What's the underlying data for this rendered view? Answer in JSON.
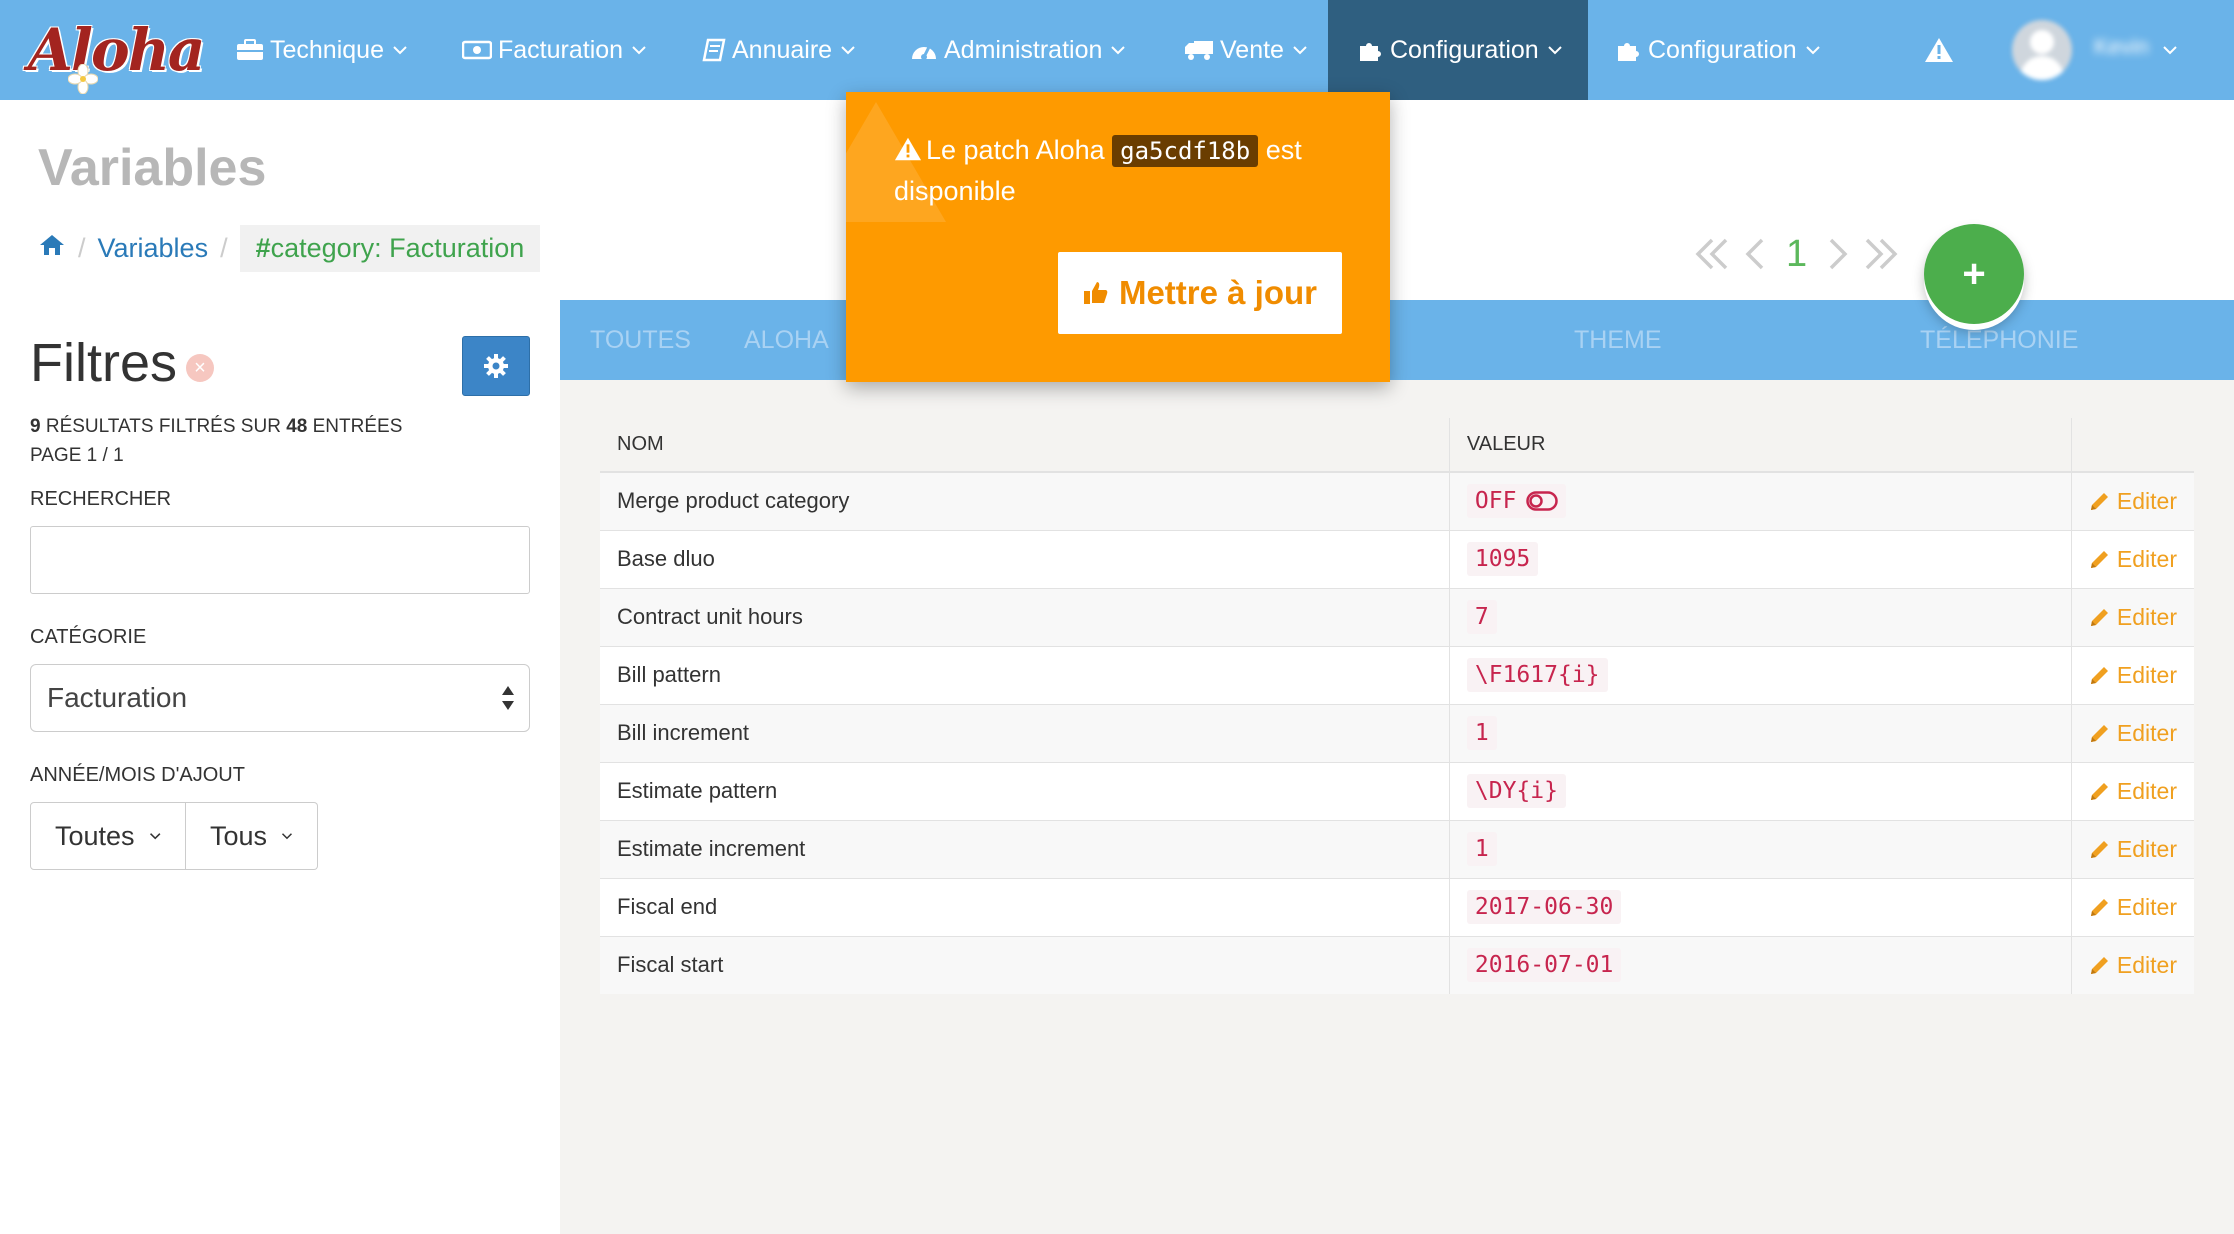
{
  "navbar": {
    "logo_text": "Aloha",
    "items": [
      {
        "label": "Technique",
        "icon": "briefcase-icon"
      },
      {
        "label": "Facturation",
        "icon": "money-icon"
      },
      {
        "label": "Annuaire",
        "icon": "book-icon"
      },
      {
        "label": "Administration",
        "icon": "dashboard-icon"
      },
      {
        "label": "Vente",
        "icon": "truck-icon"
      },
      {
        "label": "Configuration",
        "icon": "puzzle-icon",
        "active": true
      },
      {
        "label": "Configuration",
        "icon": "puzzle-icon"
      }
    ],
    "alert_icon": "warning-icon",
    "user_name": "Kevin"
  },
  "header": {
    "title": "Variables",
    "breadcrumb": {
      "home_icon": "home-icon",
      "variables": "Variables",
      "tag_hash": "#",
      "tag_label": "category: Facturation"
    },
    "pager": {
      "current_page": "1"
    },
    "add_button": "+"
  },
  "sidebar": {
    "title": "Filtres",
    "clear_icon": "×",
    "results_count": "9",
    "results_middle": " RÉSULTATS FILTRÉS SUR ",
    "results_total": "48",
    "results_end": " ENTRÉES",
    "page_info": "PAGE 1 / 1",
    "search_label": "RECHERCHER",
    "search_value": "",
    "category_label": "CATÉGORIE",
    "category_value": "Facturation",
    "date_label": "ANNÉE/MOIS D'AJOUT",
    "year_value": "Toutes",
    "month_value": "Tous"
  },
  "tabs": [
    "TOUTES",
    "ALOHA",
    "TÉLÉPHONIE",
    "THEME"
  ],
  "table": {
    "headers": {
      "name": "NOM",
      "value": "VALEUR",
      "actions": ""
    },
    "edit_label": "Editer",
    "rows": [
      {
        "name": "Merge product category",
        "value": "OFF",
        "toggle": true
      },
      {
        "name": "Base dluo",
        "value": "1095"
      },
      {
        "name": "Contract unit hours",
        "value": "7"
      },
      {
        "name": "Bill pattern",
        "value": "\\F1617{i}"
      },
      {
        "name": "Bill increment",
        "value": "1"
      },
      {
        "name": "Estimate pattern",
        "value": "\\DY{i}"
      },
      {
        "name": "Estimate increment",
        "value": "1"
      },
      {
        "name": "Fiscal end",
        "value": "2017-06-30"
      },
      {
        "name": "Fiscal start",
        "value": "2016-07-01"
      }
    ]
  },
  "popup": {
    "message_before": "Le patch Aloha ",
    "patch_code": "ga5cdf18b",
    "message_after": " est disponible",
    "button_label": "Mettre à jour"
  },
  "colors": {
    "navbar": "#6ab3e9",
    "navbar_active": "#2f5f80",
    "popup": "#fe9a00",
    "accent_green": "#4cae4c",
    "edit_orange": "#f0a020",
    "code_red": "#c7254e"
  }
}
